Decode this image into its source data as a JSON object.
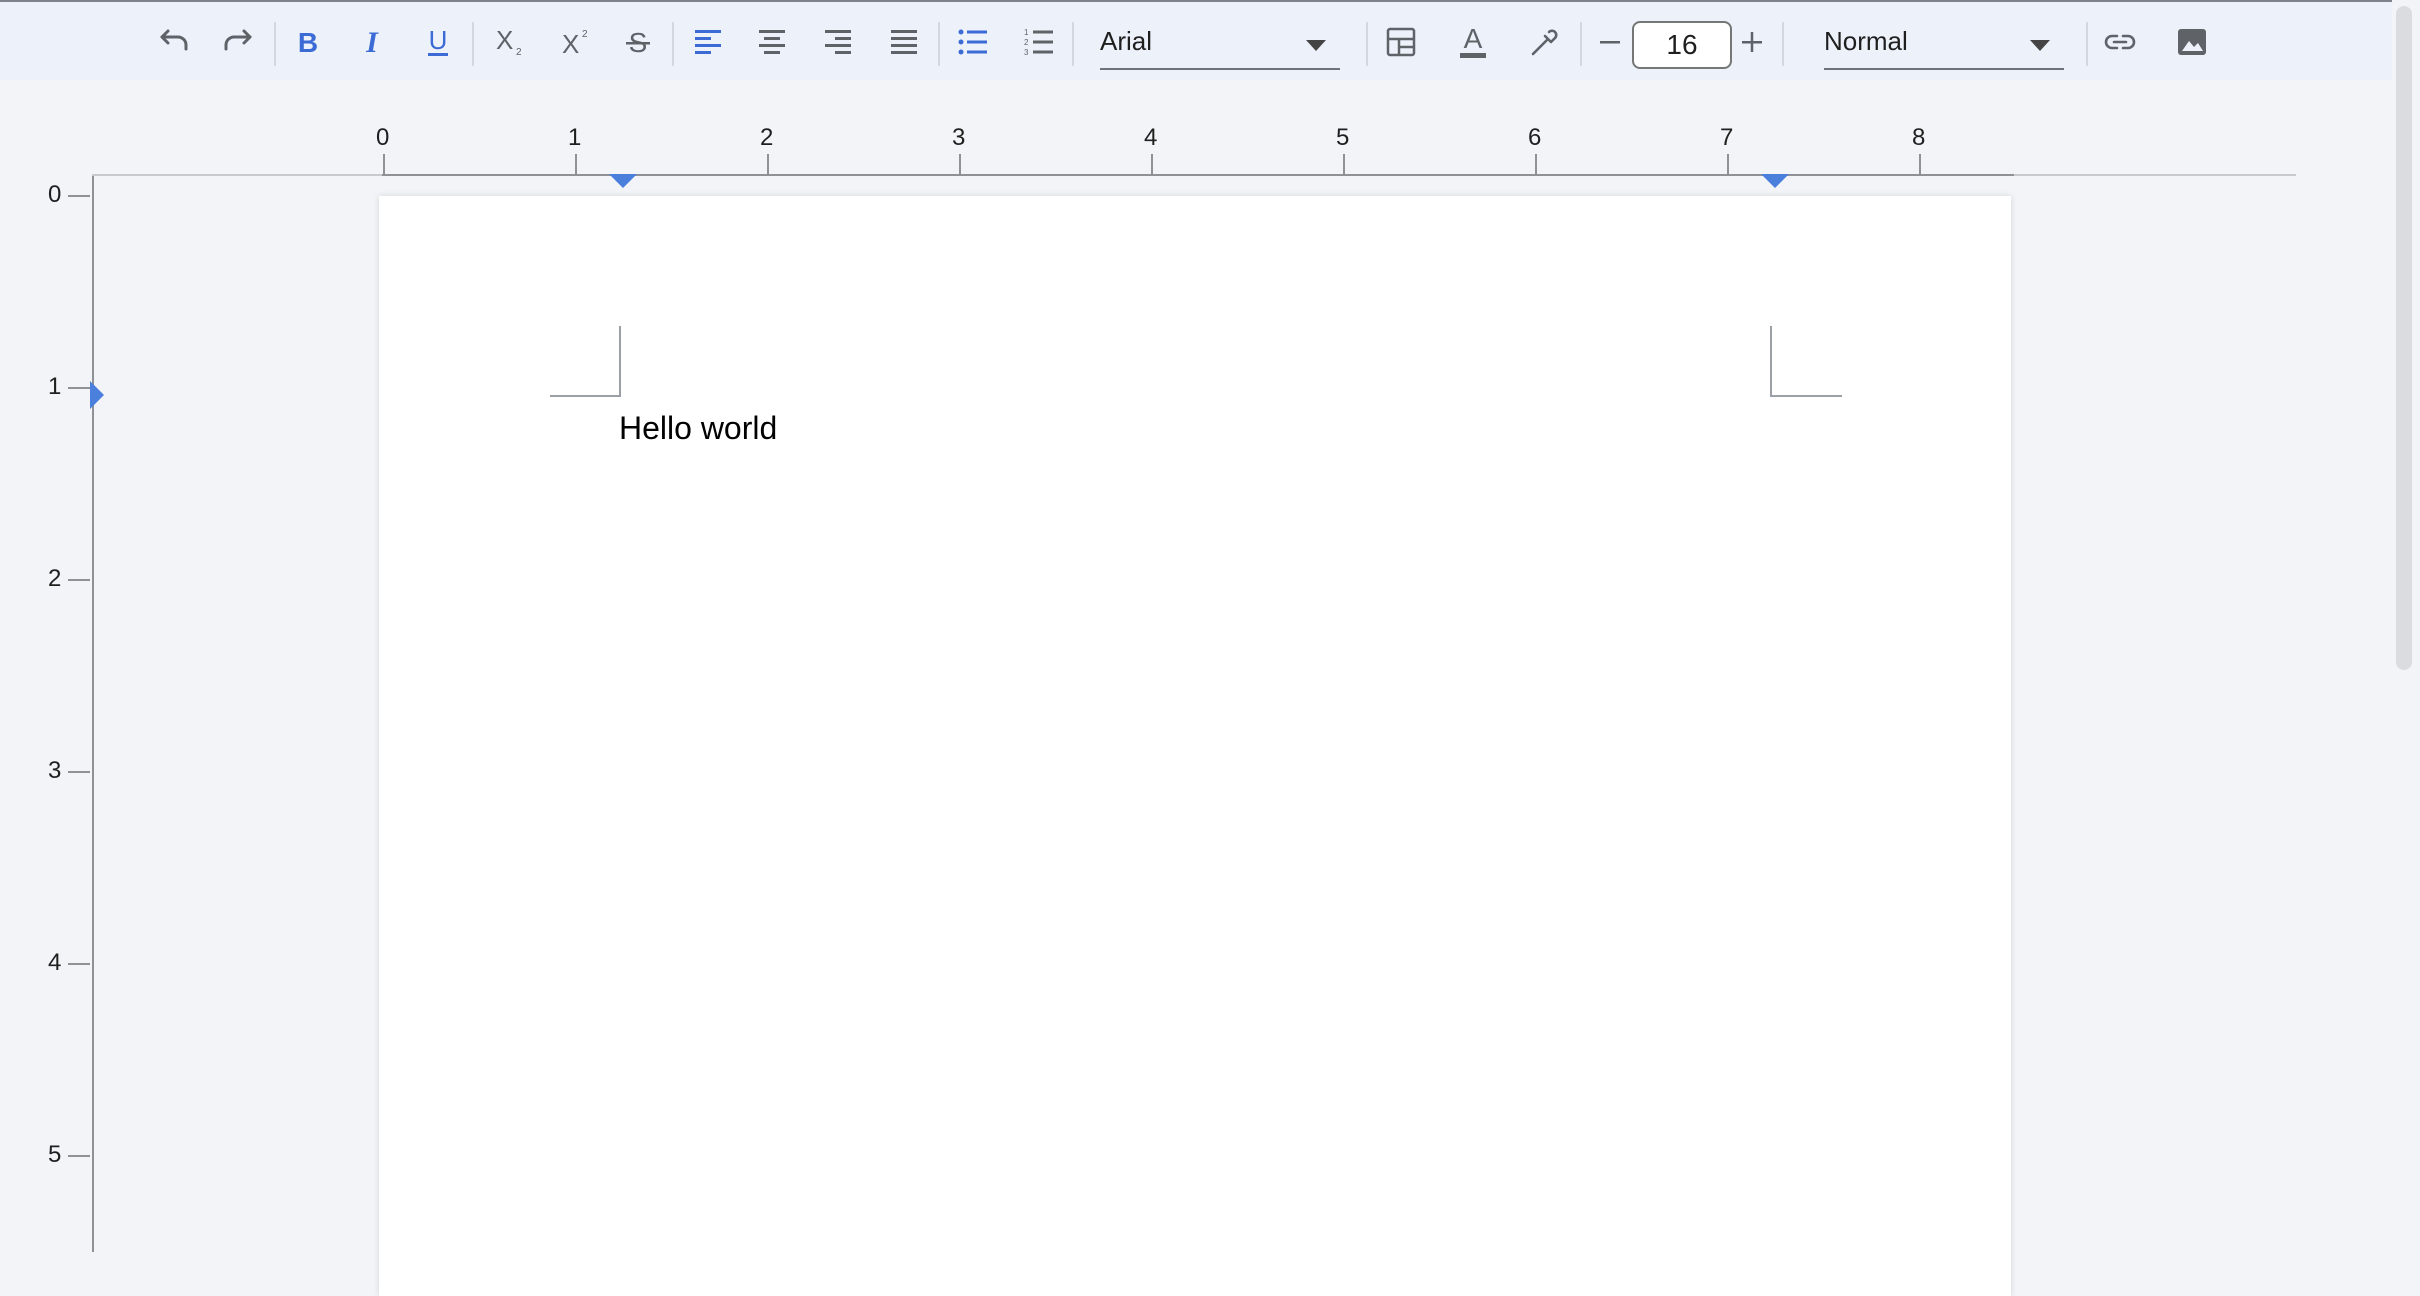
{
  "toolbar": {
    "undo": "undo-icon",
    "redo": "redo-icon",
    "bold": "bold-icon",
    "italic": "italic-icon",
    "underline": "underline-icon",
    "subscript": "subscript-icon",
    "superscript": "superscript-icon",
    "strikethrough": "strikethrough-icon",
    "align_left": "align-left-icon",
    "align_center": "align-center-icon",
    "align_right": "align-right-icon",
    "align_justify": "align-justify-icon",
    "bulleted_list": "bulleted-list-icon",
    "numbered_list": "numbered-list-icon",
    "font_family": "Arial",
    "font_size": "16",
    "paragraph_style": "Normal",
    "accent_color": "#3c6bd6",
    "icon_color": "#5f6368"
  },
  "ruler": {
    "horizontal_labels": [
      "0",
      "1",
      "2",
      "3",
      "4",
      "5",
      "6",
      "7",
      "8"
    ],
    "vertical_labels": [
      "0",
      "1",
      "2",
      "3",
      "4",
      "5"
    ],
    "marker_color": "#4a7fdb"
  },
  "document": {
    "text": "Hello world"
  }
}
